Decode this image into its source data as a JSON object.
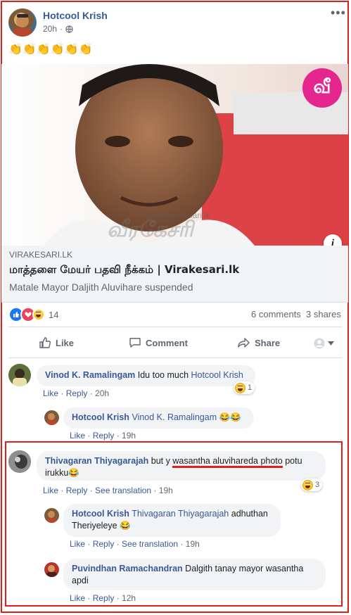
{
  "post": {
    "author": "Hotcool Krish",
    "time": "20h",
    "audience_icon": "globe-icon",
    "text": "👏👏👏👏👏👏",
    "more_icon": "more-dots-icon"
  },
  "link_card": {
    "domain": "VIRAKESARI.LK",
    "title": "மாத்தளை மேயர் பதவி நீக்கம் | Virakesari.lk",
    "description": "Matale Mayor Daljith Aluvihare suspended",
    "logo_text": "வீ",
    "watermark": "www.virakesari.lk",
    "watermark_logo": "வீரகேசரி",
    "info_icon_label": "i"
  },
  "reactions": {
    "count": "14",
    "comments": "6 comments",
    "shares": "3 shares"
  },
  "actions": {
    "like": "Like",
    "comment": "Comment",
    "share": "Share"
  },
  "comments": [
    {
      "author": "Vinod K. Ramalingam",
      "text": "Idu too much",
      "mention": "Hotcool Krish",
      "like": "Like",
      "reply": "Reply",
      "time": "20h",
      "react_count": "1"
    },
    {
      "author": "Hotcool Krish",
      "mention": "Vinod K. Ramalingam",
      "text": "😂😂",
      "like": "Like",
      "reply": "Reply",
      "time": "19h"
    },
    {
      "author": "Thivagaran Thiyagarajah",
      "text_before": "but y",
      "text_underlined": "wasantha aluvihareda photo",
      "text_after": "potu irukku😂",
      "like": "Like",
      "reply": "Reply",
      "see_translation": "See translation",
      "time": "19h",
      "react_count": "3"
    },
    {
      "author": "Hotcool Krish",
      "mention": "Thivagaran Thiyagarajah",
      "text": "adhuthan Theriyeleye 😂",
      "like": "Like",
      "reply": "Reply",
      "see_translation": "See translation",
      "time": "19h"
    },
    {
      "author": "Puvindhan Ramachandran",
      "text": "Dalgith tanay mayor wasantha apdi",
      "like": "Like",
      "reply": "Reply",
      "time": "12h"
    }
  ],
  "colors": {
    "link": "#385898",
    "highlight": "#e0201a",
    "bubble": "#f2f3f5"
  }
}
